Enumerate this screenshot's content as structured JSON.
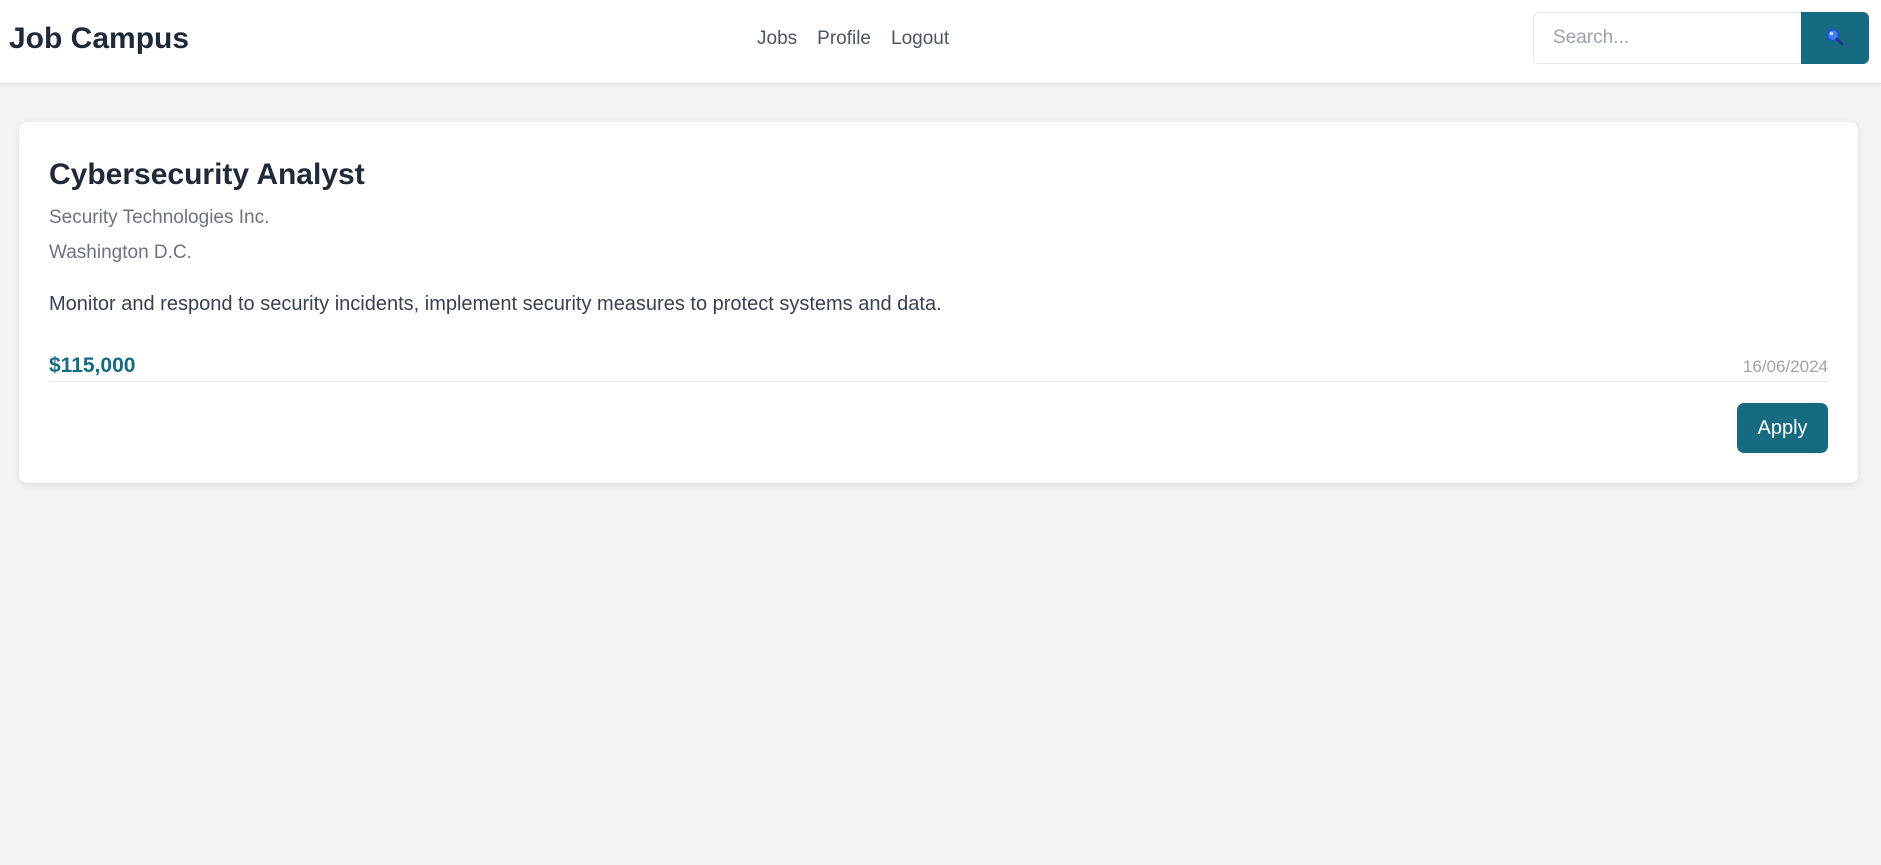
{
  "header": {
    "brand": "Job Campus",
    "nav": [
      {
        "label": "Jobs"
      },
      {
        "label": "Profile"
      },
      {
        "label": "Logout"
      }
    ],
    "search": {
      "placeholder": "Search...",
      "value": "",
      "button_icon": "search-icon"
    }
  },
  "job": {
    "title": "Cybersecurity Analyst",
    "company": "Security Technologies Inc.",
    "location": "Washington D.C.",
    "description": "Monitor and respond to security incidents, implement security measures to protect systems and data.",
    "salary": "$115,000",
    "date": "16/06/2024",
    "apply_label": "Apply"
  },
  "colors": {
    "accent": "#176b80",
    "background": "#f3f4f6",
    "card": "#ffffff",
    "text_primary": "#1f2937",
    "text_muted": "#6b7280"
  }
}
